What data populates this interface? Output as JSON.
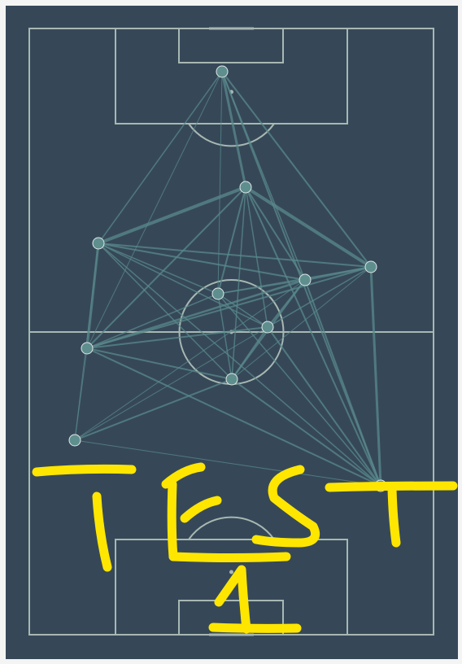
{
  "colors": {
    "background": "#364858",
    "frame": "#f4f4f4",
    "pitch_lines": "#a8b8b2",
    "pass_lines": "#5a8a8c",
    "node_fill": "#5f8e8e",
    "node_stroke": "#dfe8e6",
    "scribble": "#ffe600"
  },
  "network": {
    "players": [
      "p1",
      "p2",
      "p3",
      "p4",
      "p5",
      "p6",
      "p7",
      "p8",
      "p9",
      "p10",
      "p11"
    ],
    "passes": [
      [
        "p1",
        "p2",
        3
      ],
      [
        "p1",
        "p3",
        1.5
      ],
      [
        "p1",
        "p4",
        2
      ],
      [
        "p1",
        "p5",
        1.5
      ],
      [
        "p1",
        "p6",
        1
      ],
      [
        "p1",
        "p8",
        1
      ],
      [
        "p1",
        "p11",
        2
      ],
      [
        "p2",
        "p3",
        4
      ],
      [
        "p2",
        "p4",
        4
      ],
      [
        "p2",
        "p5",
        2
      ],
      [
        "p2",
        "p6",
        2
      ],
      [
        "p2",
        "p7",
        1.5
      ],
      [
        "p2",
        "p8",
        2
      ],
      [
        "p2",
        "p9",
        1.5
      ],
      [
        "p2",
        "p11",
        2
      ],
      [
        "p3",
        "p4",
        2
      ],
      [
        "p3",
        "p5",
        2
      ],
      [
        "p3",
        "p7",
        1.5
      ],
      [
        "p3",
        "p8",
        3
      ],
      [
        "p3",
        "p9",
        1.5
      ],
      [
        "p3",
        "p6",
        1.5
      ],
      [
        "p3",
        "p10",
        1
      ],
      [
        "p3",
        "p11",
        1.5
      ],
      [
        "p4",
        "p5",
        2.5
      ],
      [
        "p4",
        "p7",
        1.5
      ],
      [
        "p4",
        "p8",
        2
      ],
      [
        "p4",
        "p9",
        1
      ],
      [
        "p4",
        "p11",
        3
      ],
      [
        "p4",
        "p6",
        1.5
      ],
      [
        "p5",
        "p6",
        1.5
      ],
      [
        "p5",
        "p7",
        2
      ],
      [
        "p5",
        "p8",
        2.5
      ],
      [
        "p5",
        "p9",
        2
      ],
      [
        "p5",
        "p11",
        2
      ],
      [
        "p5",
        "p10",
        1
      ],
      [
        "p6",
        "p7",
        1.5
      ],
      [
        "p6",
        "p8",
        1.5
      ],
      [
        "p6",
        "p9",
        1.5
      ],
      [
        "p6",
        "p11",
        1.5
      ],
      [
        "p7",
        "p8",
        2
      ],
      [
        "p7",
        "p9",
        2
      ],
      [
        "p7",
        "p10",
        1
      ],
      [
        "p7",
        "p11",
        2
      ],
      [
        "p8",
        "p9",
        2
      ],
      [
        "p8",
        "p10",
        1
      ],
      [
        "p8",
        "p11",
        2
      ],
      [
        "p9",
        "p10",
        2
      ],
      [
        "p9",
        "p11",
        2
      ],
      [
        "p10",
        "p11",
        1
      ]
    ]
  },
  "scribble": {
    "text": "TEST 1"
  }
}
